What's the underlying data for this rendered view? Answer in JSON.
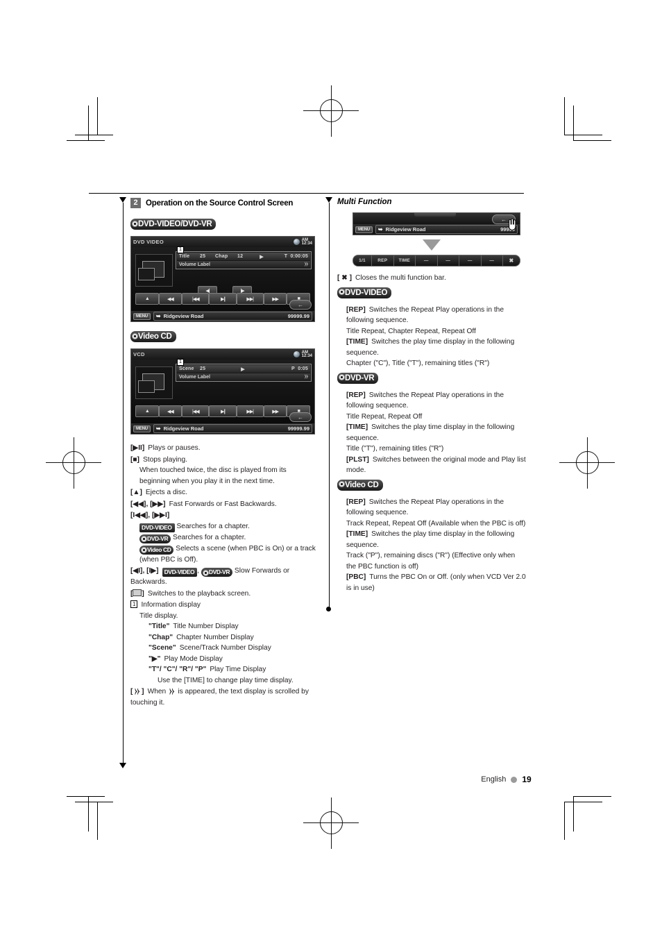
{
  "page": {
    "language": "English",
    "number": "19"
  },
  "left": {
    "step_number": "2",
    "step_title": "Operation on the Source Control Screen",
    "dvd_heading": "DVD-VIDEO/DVD-VR",
    "vcd_heading": "Video CD",
    "dvd_screen": {
      "source_label": "DVD VIDEO",
      "clock_ampm": "AM",
      "clock_time": "12:34",
      "num_tag": "1",
      "field_title_label": "Title",
      "field_title_value": "25",
      "field_chap_label": "Chap",
      "field_chap_value": "12",
      "play_mode": "▶",
      "time_label": "T",
      "time_value": "0:00:05",
      "volume_label": "Volume Label",
      "scroll_icon": "⧽⧽",
      "slow_back": "◀|",
      "slow_fwd": "|▶",
      "buttons": [
        "▲",
        "◀◀",
        "|◀◀",
        "▶||",
        "▶▶|",
        "▶▶",
        "■"
      ],
      "return_icon": "←",
      "menu_label": "MENU",
      "nav_text": "Ridgeview Road",
      "nav_distance": "99999.99"
    },
    "vcd_screen": {
      "source_label": "VCD",
      "clock_ampm": "AM",
      "clock_time": "12:34",
      "num_tag": "1",
      "field_scene_label": "Scene",
      "field_scene_value": "25",
      "play_mode": "▶",
      "time_label": "P",
      "time_value": "0:05",
      "volume_label": "Volume Label",
      "scroll_icon": "⧽⧽",
      "buttons": [
        "▲",
        "◀◀",
        "|◀◀",
        "▶||",
        "▶▶|",
        "▶▶",
        "■"
      ],
      "return_icon": "←",
      "menu_label": "MENU",
      "nav_text": "Ridgeview Road",
      "nav_distance": "99999.99"
    },
    "items": {
      "playpause_key": "[▶II]",
      "playpause_text": "Plays or pauses.",
      "stop_key": "[■]",
      "stop_text": "Stops playing.",
      "stop_note": "When touched twice, the disc is played from its beginning when you play it in the next time.",
      "eject_key": "[▲]",
      "eject_text": "Ejects a disc.",
      "ff_key": "[◀◀], [▶▶]",
      "ff_text": "Fast Forwards or Fast Backwards.",
      "skip_key": "[I◀◀], [▶▶I]",
      "skip_dvdvideo_badge": "DVD-VIDEO",
      "skip_dvdvideo_text": "Searches for a chapter.",
      "skip_dvdvr_badge": "DVD-VR",
      "skip_dvdvr_text": "Searches for a chapter.",
      "skip_vcd_badge": "Video CD",
      "skip_vcd_text": "Selects a scene (when PBC is On) or a track (when PBC is Off).",
      "slow_key": "[◀I], [I▶]",
      "slow_badge1": "DVD-VIDEO",
      "slow_badge2": "DVD-VR",
      "slow_text": "Slow Forwards or Backwards.",
      "playback_key": "[⬜]",
      "playback_text": "Switches to the playback screen.",
      "info_num": "1",
      "info_title": "Information display",
      "info_sub": "Title display.",
      "def_title_key": "\"Title\"",
      "def_title_text": "Title Number Display",
      "def_chap_key": "\"Chap\"",
      "def_chap_text": "Chapter Number Display",
      "def_scene_key": "\"Scene\"",
      "def_scene_text": "Scene/Track Number Display",
      "def_play_key": "\"▶\"",
      "def_play_text": "Play Mode Display",
      "def_time_key": "\"T\"/ \"C\"/ \"R\"/ \"P\"",
      "def_time_text": "Play Time Display",
      "def_time_note": "Use the [TIME] to change play time display.",
      "scroll_key": "[ ⧽⧽ ]",
      "scroll_text_a": "When",
      "scroll_icon": "⧽⧽",
      "scroll_text_b": "is appeared, the text display is scrolled by touching it."
    }
  },
  "right": {
    "heading": "Multi Function",
    "top_screen": {
      "return_icon": "←",
      "menu_label": "MENU",
      "nav_text": "Ridgeview Road",
      "nav_distance": "99999"
    },
    "mf_bar": {
      "page": "1/1",
      "rep": "REP",
      "time": "TIME",
      "blank": "—",
      "close": "✖"
    },
    "close_key": "[ ✖ ]",
    "close_text": "Closes the multi function bar.",
    "dvdvideo": {
      "badge": "DVD-VIDEO",
      "rep_key": "[REP]",
      "rep_text": "Switches the Repeat Play operations in the following sequence.",
      "rep_seq": "Title Repeat, Chapter Repeat, Repeat Off",
      "time_key": "[TIME]",
      "time_text": "Switches the play time display in the following sequence.",
      "time_seq": "Chapter (\"C\"), Title (\"T\"), remaining titles (\"R\")"
    },
    "dvdvr": {
      "badge": "DVD-VR",
      "rep_key": "[REP]",
      "rep_text": "Switches the Repeat Play operations in the following sequence.",
      "rep_seq": "Title Repeat, Repeat Off",
      "time_key": "[TIME]",
      "time_text": "Switches the play time display in the following sequence.",
      "time_seq": "Title (\"T\"), remaining titles (\"R\")",
      "plst_key": "[PLST]",
      "plst_text": "Switches between the original mode and Play list mode."
    },
    "videocd": {
      "badge": "Video CD",
      "rep_key": "[REP]",
      "rep_text": "Switches the Repeat Play operations in the following sequence.",
      "rep_seq": "Track Repeat, Repeat Off (Available when the PBC is off)",
      "time_key": "[TIME]",
      "time_text": "Switches the play time display in the following sequence.",
      "time_seq": "Track (\"P\"), remaining discs (\"R\") (Effective only when the PBC function is off)",
      "pbc_key": "[PBC]",
      "pbc_text": "Turns the PBC On or Off. (only when VCD Ver 2.0 is in use)"
    }
  }
}
